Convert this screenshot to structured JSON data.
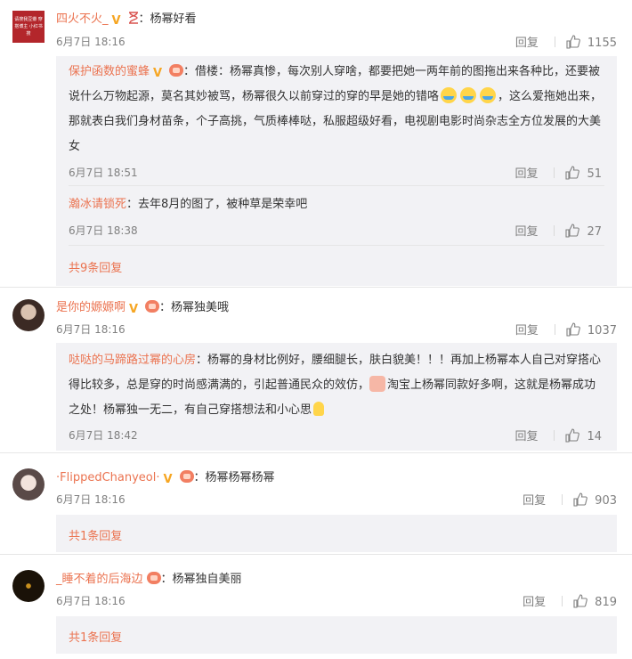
{
  "comments": [
    {
      "username": "四火不火_",
      "avatar_text": "请搜我豆瓣 穿搭博主 小红书搜",
      "text": "：杨幂好看",
      "time": "6月7日 18:16",
      "reply_label": "回复",
      "likes": "1155",
      "replies": [
        {
          "username": "保护函数的蜜蜂",
          "text": "：借楼：杨幂真惨，每次别人穿啥，都要把她一两年前的图拖出来各种比，还要被说什么万物起源，莫名其妙被骂，杨幂很久以前穿过的穿的早是她的错咯",
          "text_after": "，这么爱拖她出来，那就表白我们身材苗条，个子高挑，气质棒棒哒，私服超级好看，电视剧电影时尚杂志全方位发展的大美女",
          "time": "6月7日 18:51",
          "reply_label": "回复",
          "likes": "51"
        },
        {
          "username": "瀚冰请锁死",
          "text": "：去年8月的图了，被种草是荣幸吧",
          "time": "6月7日 18:38",
          "reply_label": "回复",
          "likes": "27"
        }
      ],
      "more_replies": "共9条回复"
    },
    {
      "username": "是你的嫄嫄啊",
      "text": "：杨幂独美哦",
      "time": "6月7日 18:16",
      "reply_label": "回复",
      "likes": "1037",
      "replies": [
        {
          "username": "哒哒的马蹄路过幂的心房",
          "text": "：杨幂的身材比例好，腰细腿长，肤白貌美！！！再加上杨幂本人自己对穿搭心得比较多，总是穿的时尚感满满的，引起普通民众的效仿，",
          "text_mid": "淘宝上杨幂同款好多啊，这就是杨幂成功之处！杨幂独一无二，有自己穿搭想法和小心思",
          "time": "6月7日 18:42",
          "reply_label": "回复",
          "likes": "14"
        }
      ]
    },
    {
      "username": "·FlippedChanyeol·",
      "text": "：杨幂杨幂杨幂",
      "time": "6月7日 18:16",
      "reply_label": "回复",
      "likes": "903",
      "more_replies": "共1条回复"
    },
    {
      "username": "_睡不着的后海边",
      "text": "：杨幂独自美丽",
      "time": "6月7日 18:16",
      "reply_label": "回复",
      "likes": "819",
      "more_replies": "共1条回复"
    }
  ]
}
